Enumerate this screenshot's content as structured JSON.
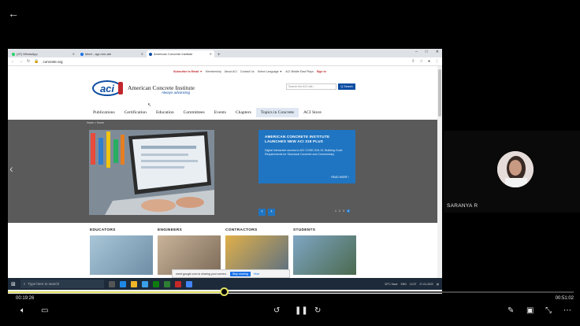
{
  "app": {
    "back_icon": "arrow-left-icon"
  },
  "browser": {
    "tabs": [
      {
        "label": "(37) WhatsApp",
        "color": "#25d366",
        "active": false
      },
      {
        "label": "Meet - agr-mnr-aie",
        "color": "#1a73e8",
        "active": false
      },
      {
        "label": "American Concrete Institute",
        "color": "#0c4da2",
        "active": true
      }
    ],
    "url": "concrete.org"
  },
  "site": {
    "utility": [
      "Subscribe to Email ▼",
      "Membership",
      "About ACI",
      "Contact Us",
      "Select Language ▼",
      "ACI Middle East Plays",
      "Sign In"
    ],
    "logo_text": "aci",
    "brand": "American Concrete Institute",
    "tagline": "Always advancing",
    "search_placeholder": "Search the ACI site...",
    "search_button": "Q Search",
    "nav": [
      "Publications",
      "Certification",
      "Education",
      "Committees",
      "Events",
      "Chapters",
      "Topics in Concrete",
      "ACI Store"
    ],
    "nav_active_index": 6,
    "breadcrumb": "Home > Home",
    "hero": {
      "title": "AMERICAN CONCRETE INSTITUTE LAUNCHES NEW ACI 318 PLUS",
      "body": "Digital interactive access to ACI CODE-318-19, Building Code Requirements for Structural Concrete and Commentary",
      "read_more": "READ MORE ›",
      "pager": [
        "1",
        "2",
        "3",
        "4"
      ]
    },
    "audience": [
      "EDUCATORS",
      "ENGINEERS",
      "CONTRACTORS",
      "STUDENTS"
    ]
  },
  "share_toast": {
    "text": "meet.google.com is sharing your screen.",
    "stop": "Stop sharing",
    "hide": "Hide"
  },
  "taskbar": {
    "search_placeholder": "Type here to search",
    "weather": "32°C Haze",
    "lang": "ENG",
    "clock_time": "12:07",
    "clock_date": "27-01-2022"
  },
  "participant": {
    "name": "SARANYA R"
  },
  "player": {
    "elapsed": "00:19:26",
    "total": "00:51:02",
    "progress": 0.381,
    "progress_color": "#e0e060"
  }
}
